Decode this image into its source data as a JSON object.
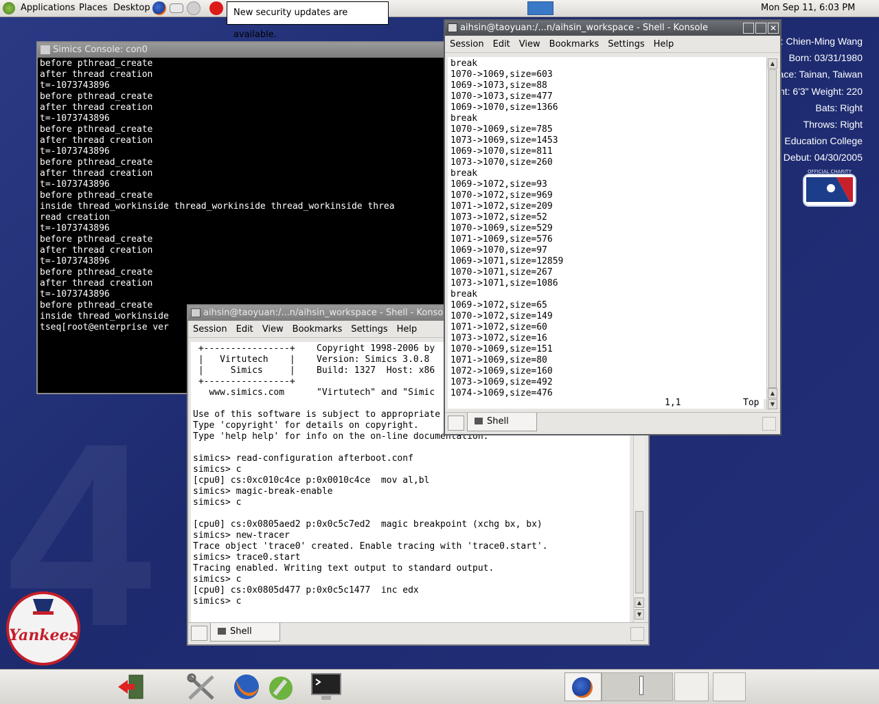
{
  "top_panel": {
    "menus": [
      "Applications",
      "Places",
      "Desktop"
    ],
    "clock": "Mon Sep 11,  6:03 PM",
    "notification": "New security updates are available."
  },
  "wallpaper": {
    "profile_lines": [
      "e: Chien-Ming Wang",
      "Born: 03/31/1980",
      "ace: Tainan, Taiwan",
      "nt: 6'3\"   Weight: 220",
      "Bats: Right",
      "Throws: Right",
      "al Education College",
      "3 Debut: 04/30/2005"
    ],
    "big_number": "4",
    "mlb_logo_text": "OFFICIAL CHARITY",
    "yankees_text": "Yankees"
  },
  "simics_console": {
    "title": "Simics Console: con0",
    "lines": [
      "before pthread_create",
      "after thread creation",
      "t=-1073743896",
      "before pthread_create",
      "after thread creation",
      "t=-1073743896",
      "before pthread_create",
      "after thread creation",
      "t=-1073743896",
      "before pthread_create",
      "after thread creation",
      "t=-1073743896",
      "before pthread_create",
      "inside thread_workinside thread_workinside thread_workinside threa",
      "read creation",
      "t=-1073743896",
      "before pthread_create",
      "after thread creation",
      "t=-1073743896",
      "before pthread_create",
      "after thread creation",
      "t=-1073743896",
      "before pthread_create",
      "inside thread_workinside",
      "tseq[root@enterprise ver"
    ]
  },
  "konsole_simics": {
    "title": "aihsin@taoyuan:/...n/aihsin_workspace - Shell - Konso",
    "menu": [
      "Session",
      "Edit",
      "View",
      "Bookmarks",
      "Settings",
      "Help"
    ],
    "lines": [
      " +----------------+    Copyright 1998-2006 by",
      " |   Virtutech    |    Version: Simics 3.0.8",
      " |     Simics     |    Build: 1327  Host: x86",
      " +----------------+",
      "   www.simics.com      \"Virtutech\" and \"Simic",
      "",
      "Use of this software is subject to appropriate",
      "Type 'copyright' for details on copyright.",
      "Type 'help help' for info on the on-line documentation.",
      "",
      "simics> read-configuration afterboot.conf",
      "simics> c",
      "[cpu0] cs:0xc010c4ce p:0x0010c4ce  mov al,bl",
      "simics> magic-break-enable",
      "simics> c",
      "",
      "[cpu0] cs:0x0805aed2 p:0x0c5c7ed2  magic breakpoint (xchg bx, bx)",
      "simics> new-tracer",
      "Trace object 'trace0' created. Enable tracing with 'trace0.start'.",
      "simics> trace0.start",
      "Tracing enabled. Writing text output to standard output.",
      "simics> c",
      "[cpu0] cs:0x0805d477 p:0x0c5c1477  inc edx",
      "simics> c",
      ""
    ],
    "tab_label": "Shell"
  },
  "konsole_vim": {
    "title": "aihsin@taoyuan:/...n/aihsin_workspace - Shell - Konsole",
    "menu": [
      "Session",
      "Edit",
      "View",
      "Bookmarks",
      "Settings",
      "Help"
    ],
    "lines": [
      "break",
      "1070->1069,size=603",
      "1069->1073,size=88",
      "1070->1073,size=477",
      "1069->1070,size=1366",
      "break",
      "1070->1069,size=785",
      "1073->1069,size=1453",
      "1069->1070,size=811",
      "1073->1070,size=260",
      "break",
      "1069->1072,size=93",
      "1070->1072,size=969",
      "1071->1072,size=209",
      "1073->1072,size=52",
      "1070->1069,size=529",
      "1071->1069,size=576",
      "1069->1070,size=97",
      "1069->1071,size=12859",
      "1070->1071,size=267",
      "1073->1071,size=1086",
      "break",
      "1069->1072,size=65",
      "1070->1072,size=149",
      "1071->1072,size=60",
      "1073->1072,size=16",
      "1070->1069,size=151",
      "1071->1069,size=80",
      "1072->1069,size=160",
      "1073->1069,size=492",
      "1074->1069,size=476"
    ],
    "status_pos": "1,1",
    "status_where": "Top",
    "tab_label": "Shell"
  },
  "bottom_panel": {
    "launchers": [
      "logout-icon",
      "tools-icon",
      "firefox-icon",
      "system-settings-icon",
      "terminal-icon"
    ]
  }
}
